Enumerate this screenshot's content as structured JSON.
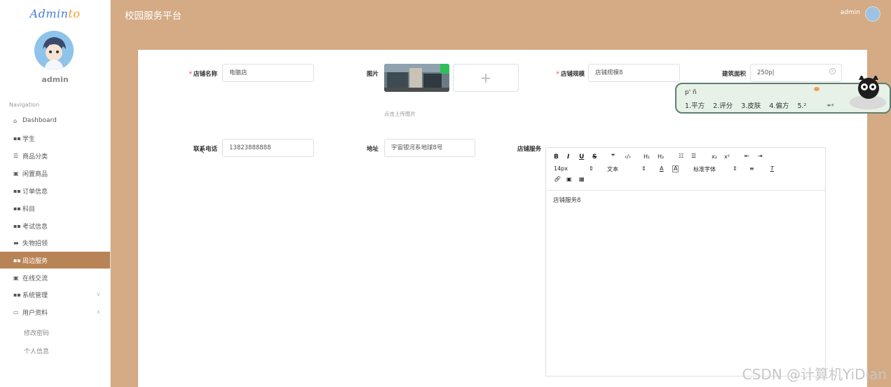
{
  "sidebar": {
    "logo_main": "Admin",
    "logo_accent": "to",
    "user_name": "admin",
    "nav_header": "Navigation",
    "items": [
      {
        "label": "Dashboard",
        "icon": "home-icon"
      },
      {
        "label": "学生",
        "icon": "grid-icon"
      },
      {
        "label": "商品分类",
        "icon": "list-icon"
      },
      {
        "label": "闲置商品",
        "icon": "box-icon"
      },
      {
        "label": "订单信息",
        "icon": "grid-icon"
      },
      {
        "label": "科目",
        "icon": "grid-icon"
      },
      {
        "label": "考试信息",
        "icon": "grid-icon"
      },
      {
        "label": "失物招领",
        "icon": "inbox-icon"
      },
      {
        "label": "周边服务",
        "icon": "grid-icon",
        "active": true
      },
      {
        "label": "在线交流",
        "icon": "box-icon"
      },
      {
        "label": "系统管理",
        "icon": "grid-icon"
      },
      {
        "label": "用户资料",
        "icon": "card-icon"
      }
    ],
    "sub_items": [
      "修改密码",
      "个人信息"
    ]
  },
  "topbar": {
    "title": "校园服务平台",
    "user": "admin"
  },
  "form": {
    "shop_name_label": "店铺名称",
    "shop_name_value": "电脑店",
    "image_label": "图片",
    "upload_plus": "+",
    "upload_tip": "点击上传图片",
    "scale_label": "店铺规模",
    "scale_value": "店铺规模8",
    "area_label": "建筑面积",
    "area_value": "250p|",
    "phone_label": "联系电话",
    "phone_value": "13823888888",
    "address_label": "地址",
    "address_value": "宇宙银河系地球8号",
    "service_label": "店铺服务"
  },
  "editor": {
    "font_size": "14px",
    "text_type": "文本",
    "font_family": "标准字体",
    "content": "店铺服务8"
  },
  "ime": {
    "input": "p' ñ",
    "candidates": [
      "1.平方",
      "2.评分",
      "3.皮肤",
      "4.偏方",
      "5.²"
    ]
  },
  "watermark": "CSDN @计算机YiDian",
  "colors": {
    "background": "#d4ab84",
    "active_menu": "#b98455",
    "required": "#f56c6c"
  }
}
